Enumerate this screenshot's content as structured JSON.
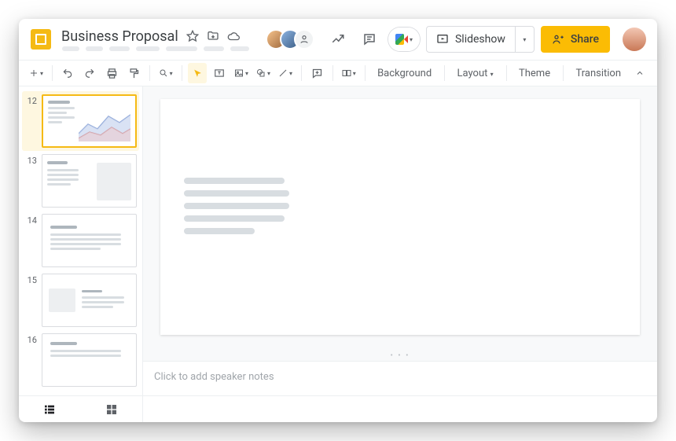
{
  "header": {
    "doc_title": "Business Proposal",
    "slideshow_label": "Slideshow",
    "share_label": "Share"
  },
  "toolbar": {
    "background": "Background",
    "layout": "Layout",
    "theme": "Theme",
    "transition": "Transition"
  },
  "filmstrip": {
    "slides": [
      {
        "num": "12"
      },
      {
        "num": "13"
      },
      {
        "num": "14"
      },
      {
        "num": "15"
      },
      {
        "num": "16"
      }
    ]
  },
  "notes": {
    "placeholder": "Click to add speaker notes"
  },
  "colors": {
    "accent": "#fbbc04",
    "logo": "#f5ba14"
  }
}
